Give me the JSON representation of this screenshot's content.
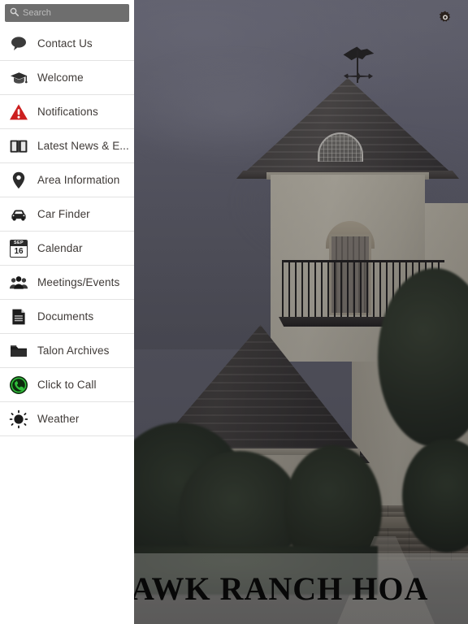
{
  "app": {
    "title_overlay": "AWK RANCH HOA"
  },
  "search": {
    "placeholder": "Search",
    "value": "",
    "icon": "search-icon"
  },
  "sidebar": {
    "items": [
      {
        "label": "Contact Us",
        "icon": "speech-bubble-icon"
      },
      {
        "label": "Welcome",
        "icon": "graduation-cap-icon"
      },
      {
        "label": "Notifications",
        "icon": "warning-triangle-icon"
      },
      {
        "label": "Latest News & E...",
        "icon": "open-book-icon"
      },
      {
        "label": "Area Information",
        "icon": "map-pin-icon"
      },
      {
        "label": "Car Finder",
        "icon": "car-icon"
      },
      {
        "label": "Calendar",
        "icon": "calendar-icon",
        "calendar_month": "SEP",
        "calendar_day": "16"
      },
      {
        "label": "Meetings/Events",
        "icon": "people-group-icon"
      },
      {
        "label": "Documents",
        "icon": "document-icon"
      },
      {
        "label": "Talon Archives",
        "icon": "folder-icon"
      },
      {
        "label": "Click to Call",
        "icon": "phone-circle-icon"
      },
      {
        "label": "Weather",
        "icon": "sun-icon"
      }
    ]
  },
  "header": {
    "settings_icon": "gear-icon"
  },
  "colors": {
    "sidebar_background": "#ffffff",
    "search_background": "#6e6e6e",
    "menu_text": "#3f3a37",
    "divider": "#e3e3e3",
    "notification_red": "#cc1f1f",
    "call_green": "#1f8a30",
    "title_text": "#080808",
    "sky": "#6a6a78"
  }
}
